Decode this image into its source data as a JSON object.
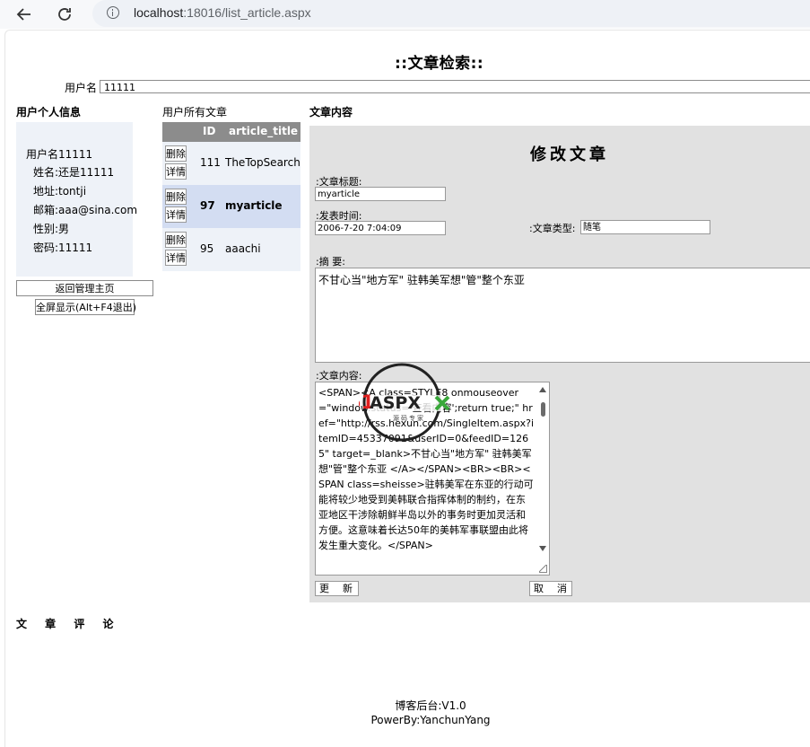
{
  "browser": {
    "url_host": "localhost",
    "url_rest": ":18016/list_article.aspx"
  },
  "page": {
    "title": "::文章检索::",
    "user_field_label": "用户名",
    "user_field_value": "11111"
  },
  "sections": {
    "user_info": "用户个人信息",
    "user_articles": "用户所有文章",
    "article_content": "文章内容",
    "comments": "文 章 评 论"
  },
  "user_info": [
    {
      "key": "用户名",
      "value": "11111"
    },
    {
      "key": "姓名:",
      "value": "还是11111"
    },
    {
      "key": "地址:",
      "value": "tontji"
    },
    {
      "key": "邮箱:",
      "value": "aaa@sina.com"
    },
    {
      "key": "性别:",
      "value": "男"
    },
    {
      "key": "密码:",
      "value": "11111"
    }
  ],
  "buttons": {
    "back": "返回管理主页",
    "fullscreen": "全屏显示(Alt+F4退出)"
  },
  "article_grid": {
    "col_id": "ID",
    "col_title": "article_title",
    "delete_label": "删除",
    "detail_label": "详情",
    "rows": [
      {
        "id": "111",
        "title": "TheTopSearch",
        "selected": false
      },
      {
        "id": "97",
        "title": "myarticle",
        "selected": true
      },
      {
        "id": "95",
        "title": "aaachi",
        "selected": false
      }
    ]
  },
  "edit_form": {
    "heading": "修改文章",
    "title_label": ":文章标题:",
    "title_value": "myarticle",
    "time_label": ":发表时间:",
    "time_value": "2006-7-20 7:04:09",
    "type_label": ":文章类型:",
    "type_value": "随笔",
    "summary_label": ":摘 要:",
    "summary_value": "不甘心当\"地方军\" 驻韩美军想\"管\"整个东亚",
    "content_label": ":文章内容:",
    "content_value": "<SPAN><A class=STYLE8 onmouseover=\"window.status='查看内容';return true;\" href=\"http://rss.hexun.com/SingleItem.aspx?itemID=45337091&userID=0&feedID=1265\" target=_blank>不甘心当\"地方军\" 驻韩美军想\"管\"整个东亚 </A></SPAN><BR><BR><SPAN class=sheisse>驻韩美军在东亚的行动可能将较少地受到美韩联合指挥体制的制约，在东亚地区干涉除朝鲜半岛以外的事务时更加灵活和方便。这意味着长达50年的美韩军事联盟由此将发生重大变化。</SPAN>",
    "update_label": "更新",
    "cancel_label": "取消"
  },
  "watermark": {
    "brand": "51ASPX",
    "tagline": "源码专家"
  },
  "footer": {
    "line1": "博客后台:V1.0",
    "line2": "PowerBy:YanchunYang"
  }
}
